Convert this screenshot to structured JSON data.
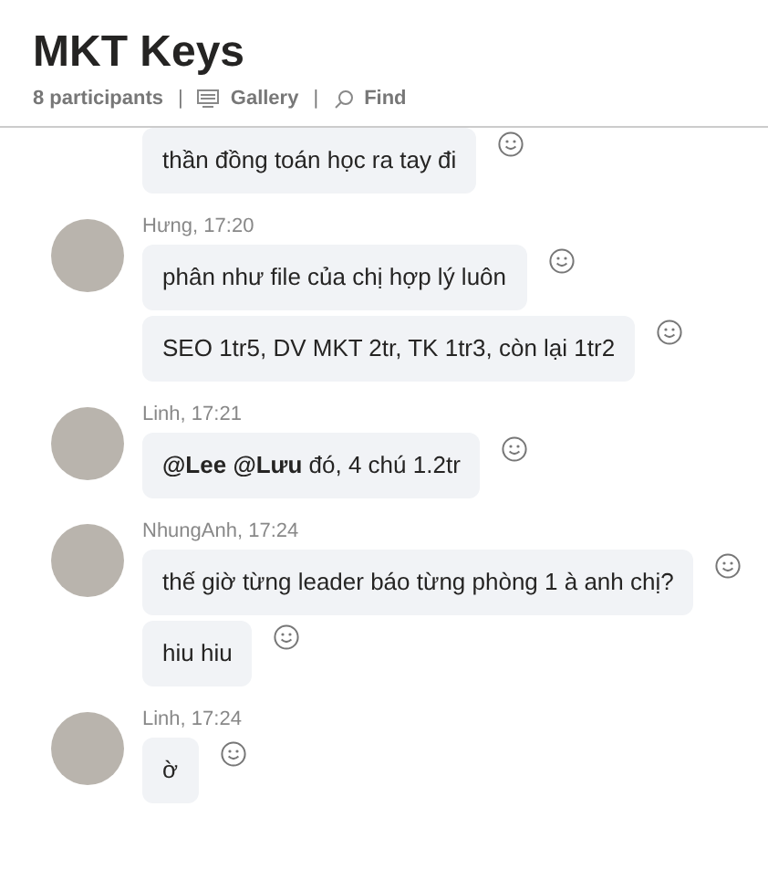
{
  "header": {
    "title": "MKT Keys",
    "participants": "8 participants",
    "separator_1": "|",
    "gallery": "Gallery",
    "separator_2": "|",
    "find": "Find"
  },
  "groups": [
    {
      "messages": [
        "thần đồng toán học ra tay đi"
      ]
    },
    {
      "sender": "Hưng, 17:20",
      "messages": [
        "phân như file của chị hợp lý luôn",
        "SEO 1tr5, DV MKT 2tr, TK 1tr3, còn lại 1tr2"
      ]
    },
    {
      "sender": "Linh, 17:21",
      "messages": [
        "**@Lee @Lưu** đó, 4 chú 1.2tr"
      ]
    },
    {
      "sender": "NhungAnh, 17:24",
      "messages": [
        "thế giờ từng leader báo từng phòng 1 à anh chị?",
        "hiu hiu"
      ]
    },
    {
      "sender": "Linh, 17:24",
      "messages": [
        "ờ"
      ]
    }
  ]
}
